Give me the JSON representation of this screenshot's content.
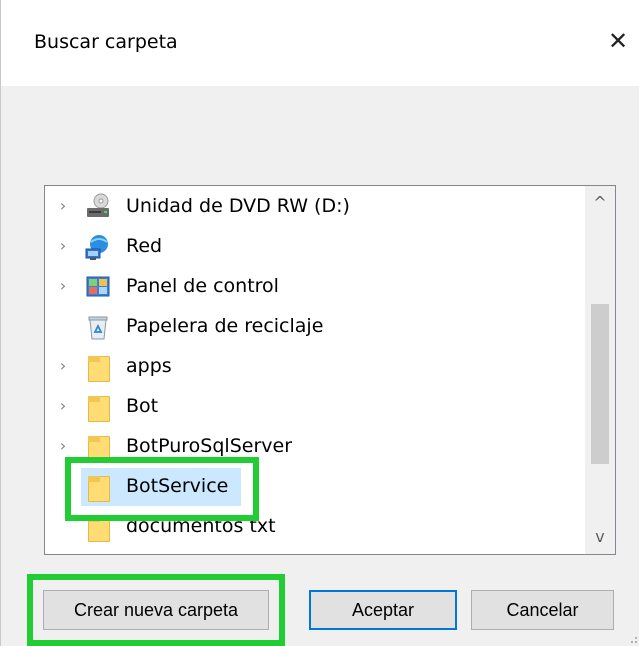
{
  "window": {
    "title": "Buscar carpeta",
    "close_glyph": "✕"
  },
  "tree": {
    "items": [
      {
        "label": "Unidad de DVD RW (D:)",
        "icon": "dvd-drive-icon",
        "expandable": true
      },
      {
        "label": "Red",
        "icon": "network-icon",
        "expandable": true
      },
      {
        "label": "Panel de control",
        "icon": "control-panel-icon",
        "expandable": true
      },
      {
        "label": "Papelera de reciclaje",
        "icon": "recycle-bin-icon",
        "expandable": false
      },
      {
        "label": "apps",
        "icon": "folder-icon",
        "expandable": true
      },
      {
        "label": "Bot",
        "icon": "folder-icon",
        "expandable": true
      },
      {
        "label": "BotPuroSqlServer",
        "icon": "folder-icon",
        "expandable": true
      },
      {
        "label": "BotService",
        "icon": "folder-icon",
        "expandable": false,
        "selected": true
      },
      {
        "label": "documentos txt",
        "icon": "folder-icon",
        "expandable": false
      }
    ],
    "chevron_glyph": "›",
    "scroll_up_glyph": "^",
    "scroll_down_glyph": "v"
  },
  "buttons": {
    "new_folder": "Crear nueva carpeta",
    "accept": "Aceptar",
    "cancel": "Cancelar"
  },
  "colors": {
    "highlight": "#22cc33",
    "selection": "#cce8ff",
    "primary_border": "#0078d7"
  }
}
